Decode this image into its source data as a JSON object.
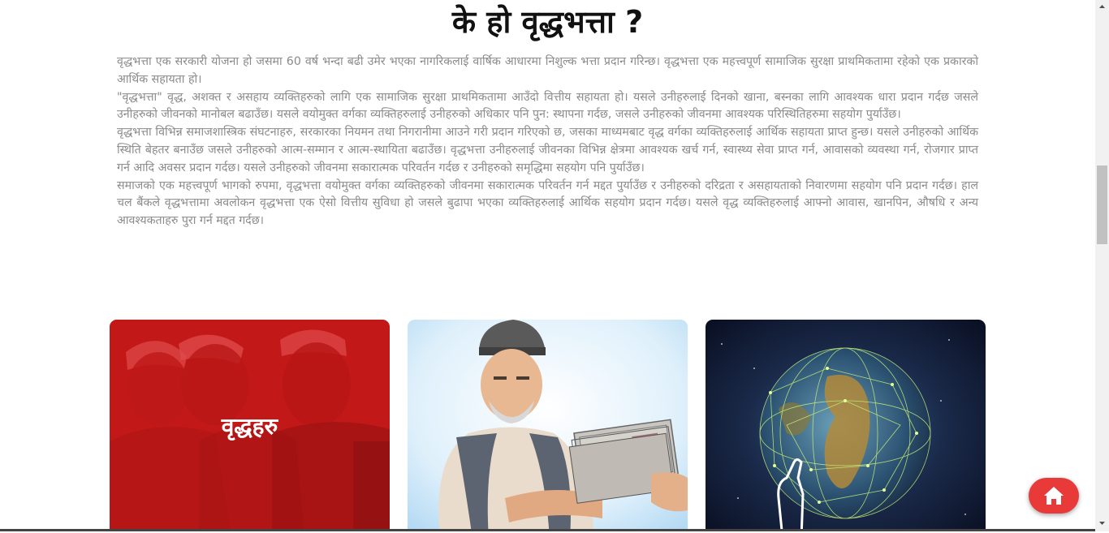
{
  "heading": "के हो वृद्धभत्ता ?",
  "paragraphs": [
    "वृद्धभत्ता एक सरकारी योजना हो जसमा 60 वर्ष भन्दा बढी उमेर भएका नागरिकलाई वार्षिक आधारमा निशुल्क भत्ता प्रदान गरिन्छ। वृद्धभत्ता एक महत्त्वपूर्ण सामाजिक सुरक्षा प्राथमिकतामा रहेको एक प्रकारको आर्थिक सहायता हो।",
    "\"वृद्धभत्ता\" वृद्ध, अशक्त र असहाय व्यक्तिहरुको लागि एक सामाजिक सुरक्षा प्राथमिकतामा आउँदो वित्तीय सहायता हो। यसले उनीहरुलाई दिनको खाना, बस्नका लागि आवश्यक धारा प्रदान गर्दछ जसले उनीहरुको जीवनको मानोबल बढाउँछ। यसले वयोमुक्त वर्गका व्यक्तिहरुलाई उनीहरुको अधिकार पनि पुन: स्थापना गर्दछ, जसले उनीहरुको जीवनमा आवश्यक परिस्थितिहरुमा सहयोग पुर्याउँछ।",
    "वृद्धभत्ता विभिन्न समाजशास्त्रिक संघटनाहरु, सरकारका नियमन तथा निगरानीमा आउने गरी प्रदान गरिएको छ, जसका माध्यमबाट वृद्ध वर्गका व्यक्तिहरुलाई आर्थिक सहायता प्राप्त हुन्छ। यसले उनीहरुको आर्थिक स्थिति बेहतर बनाउँछ जसले उनीहरुको आत्म-सम्मान र आत्म-स्थायिता बढाउँछ। वृद्धभत्ता उनीहरुलाई जीवनका विभिन्न क्षेत्रमा आवश्यक खर्च गर्न, स्वास्थ्य सेवा प्राप्त गर्न, आवासको व्यवस्था गर्न, रोजगार प्राप्त गर्न आदि अवसर प्रदान गर्दछ। यसले उनीहरुको जीवनमा सकारात्मक परिवर्तन गर्दछ र उनीहरुको समृद्धिमा सहयोग पनि पुर्याउँछ।",
    "समाजको एक महत्त्वपूर्ण भागको रुपमा, वृद्धभत्ता वयोमुक्त वर्गका व्यक्तिहरुको जीवनमा सकारात्मक परिवर्तन गर्न मद्दत पुर्याउँछ र उनीहरुको दरिद्रता र असहायताको निवारणमा सहयोग पनि प्रदान गर्दछ। हाल चल बैंकले वृद्धभत्तामा अवलोकन वृद्धभत्ता एक ऐसो वित्तीय सुविधा हो जसले बुढापा भएका व्यक्तिहरुलाई आर्थिक सहयोग प्रदान गर्दछ। यसले वृद्ध व्यक्तिहरुलाई आफ्नो आवास, खानपिन, औषधि र अन्य आवश्यकताहरु पुरा गर्न मद्दत गर्दछ।"
  ],
  "cards": [
    {
      "label": "वृद्धहरु",
      "icon": "elderly-people-photo"
    },
    {
      "label": "",
      "icon": "elderly-man-receiving-money-illustration"
    },
    {
      "label": "",
      "icon": "digital-globe-touch-photo"
    }
  ],
  "home_button": {
    "icon": "home-icon"
  },
  "colors": {
    "accent": "#e93a3a",
    "text_muted": "#8a8a8a",
    "card_overlay": "#d61f1f"
  }
}
